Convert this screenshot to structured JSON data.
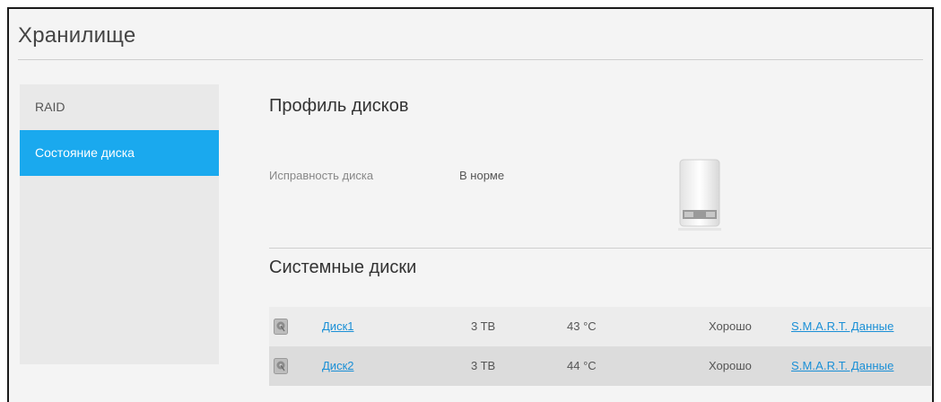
{
  "page": {
    "title": "Хранилище"
  },
  "sidebar": {
    "items": [
      {
        "label": "RAID",
        "active": false
      },
      {
        "label": "Состояние диска",
        "active": true
      }
    ]
  },
  "profile": {
    "title": "Профиль дисков",
    "health_label": "Исправность диска",
    "health_value": "В норме",
    "device_icon": "nas-device-icon"
  },
  "system_disks": {
    "title": "Системные диски",
    "rows": [
      {
        "icon": "disk-icon",
        "name": "Диск1",
        "size": "3 TB",
        "temp": "43 °C",
        "status": "Хорошо",
        "smart": "S.M.A.R.T. Данные"
      },
      {
        "icon": "disk-icon",
        "name": "Диск2",
        "size": "3 TB",
        "temp": "44 °C",
        "status": "Хорошо",
        "smart": "S.M.A.R.T. Данные"
      }
    ]
  },
  "colors": {
    "accent": "#1aa9ee",
    "link": "#1a8fd6",
    "sidebar_bg": "#e9e9e9",
    "page_bg": "#f4f4f4"
  }
}
